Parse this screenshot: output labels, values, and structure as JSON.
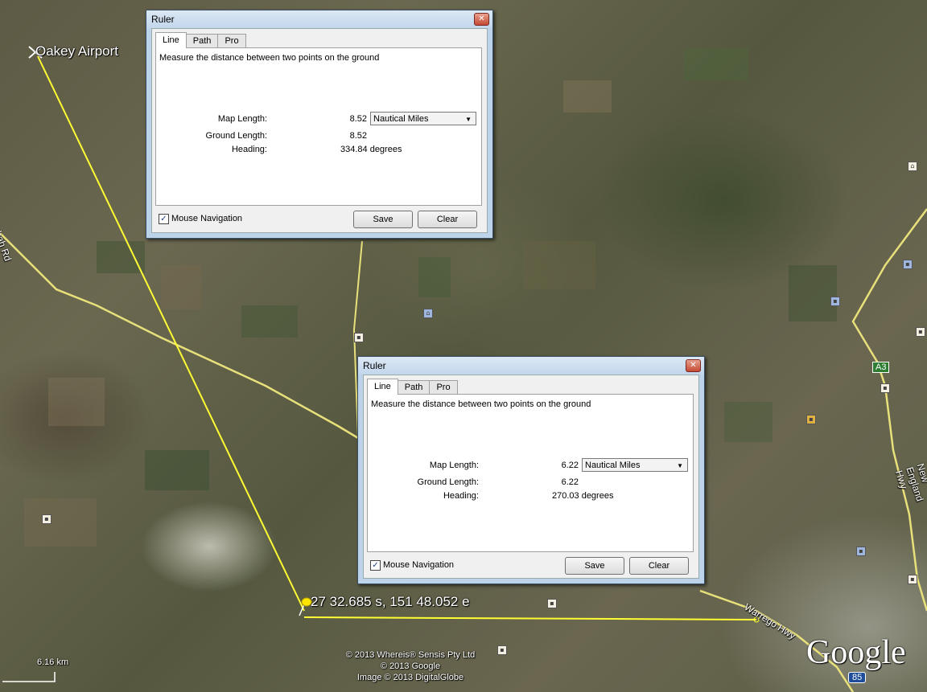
{
  "map": {
    "airport_label": "Oakey Airport",
    "coord_label": "27 32.685 s, 151 48.052 e",
    "road_label_left": "ombah Rd",
    "road_label_warrego": "Warrego Hwy",
    "road_label_ne": "New England Hwy",
    "shield_a3": "A3",
    "shield_85": "85",
    "scale_label": "6.16 km",
    "copyright_lines": [
      "© 2013 Whereis® Sensis Pty Ltd",
      "© 2013 Google",
      "Image © 2013 DigitalGlobe"
    ],
    "logo": "Google"
  },
  "rulers": [
    {
      "title": "Ruler",
      "tabs": [
        "Line",
        "Path",
        "Pro"
      ],
      "active_tab": "Line",
      "description": "Measure the distance between two points on the ground",
      "map_length_label": "Map Length:",
      "map_length_value": "8.52",
      "units": "Nautical Miles",
      "ground_length_label": "Ground Length:",
      "ground_length_value": "8.52",
      "heading_label": "Heading:",
      "heading_value": "334.84 degrees",
      "mouse_navigation_label": "Mouse Navigation",
      "mouse_navigation_checked": true,
      "save_label": "Save",
      "clear_label": "Clear"
    },
    {
      "title": "Ruler",
      "tabs": [
        "Line",
        "Path",
        "Pro"
      ],
      "active_tab": "Line",
      "description": "Measure the distance between two points on the ground",
      "map_length_label": "Map Length:",
      "map_length_value": "6.22",
      "units": "Nautical Miles",
      "ground_length_label": "Ground Length:",
      "ground_length_value": "6.22",
      "heading_label": "Heading:",
      "heading_value": "270.03 degrees",
      "mouse_navigation_label": "Mouse Navigation",
      "mouse_navigation_checked": true,
      "save_label": "Save",
      "clear_label": "Clear"
    }
  ],
  "colors": {
    "ruler_line": "#ffff33",
    "road": "#e8e07a",
    "pin": "#ffe600"
  }
}
